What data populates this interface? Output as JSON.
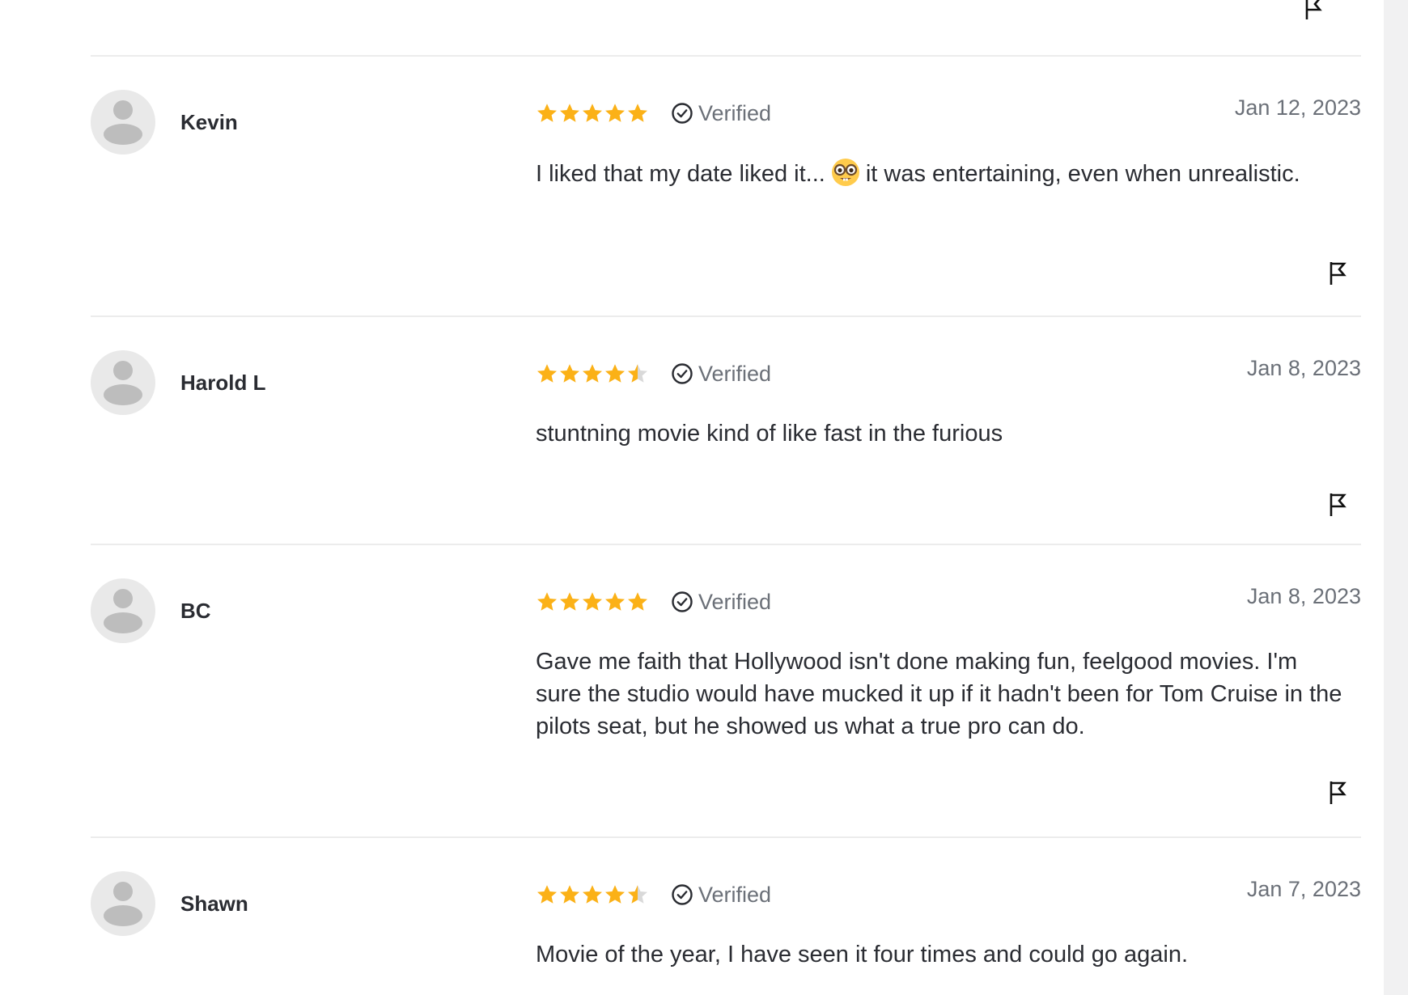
{
  "colors": {
    "star_fill": "#fbb117",
    "star_empty": "#d9d9d9",
    "text": "#2a2c32",
    "muted": "#6b7078",
    "divider": "#ececec",
    "avatar_bg": "#e9e9e9",
    "avatar_fg": "#bdbdbd"
  },
  "reviews": [
    {
      "user": "Kevin",
      "rating": 5,
      "verified_label": "Verified",
      "date": "Jan 12, 2023",
      "text_before_emoji": "I liked that my date liked it...",
      "emoji": "nerd-face",
      "text_after_emoji": "it was entertaining, even when unrealistic."
    },
    {
      "user": "Harold L",
      "rating": 4.5,
      "verified_label": "Verified",
      "date": "Jan 8, 2023",
      "text": "stuntning movie kind of like fast in the furious"
    },
    {
      "user": "BC",
      "rating": 5,
      "verified_label": "Verified",
      "date": "Jan 8, 2023",
      "text": "Gave me faith that Hollywood isn't done making fun, feelgood movies. I'm sure the studio would have mucked it up if it hadn't been for Tom Cruise in the pilots seat, but he showed us what a true pro can do."
    },
    {
      "user": "Shawn",
      "rating": 4.5,
      "verified_label": "Verified",
      "date": "Jan 7, 2023",
      "text": "Movie of the year, I have seen it four times and could go again."
    }
  ]
}
